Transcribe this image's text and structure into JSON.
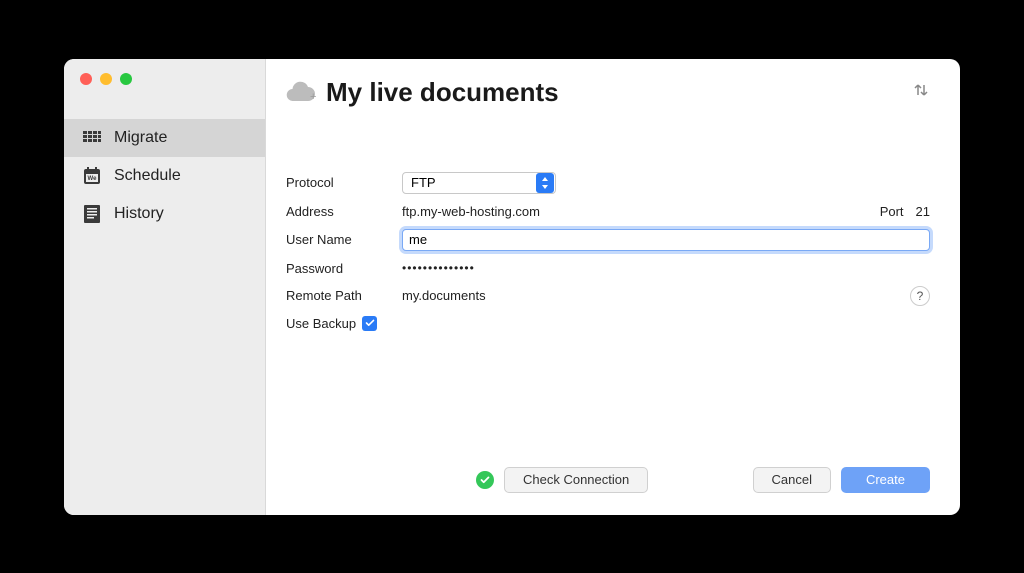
{
  "header": {
    "title": "My live documents"
  },
  "sidebar": {
    "items": [
      {
        "label": "Migrate",
        "active": true
      },
      {
        "label": "Schedule",
        "active": false
      },
      {
        "label": "History",
        "active": false
      }
    ]
  },
  "form": {
    "protocol_label": "Protocol",
    "protocol_value": "FTP",
    "address_label": "Address",
    "address_value": "ftp.my-web-hosting.com",
    "port_label": "Port",
    "port_value": "21",
    "username_label": "User Name",
    "username_value": "me",
    "password_label": "Password",
    "password_masked": "••••••••••••••",
    "remote_path_label": "Remote Path",
    "remote_path_value": "my.documents",
    "use_backup_label": "Use Backup",
    "use_backup_checked": true,
    "help_label": "?"
  },
  "footer": {
    "check_connection_label": "Check Connection",
    "cancel_label": "Cancel",
    "create_label": "Create"
  }
}
